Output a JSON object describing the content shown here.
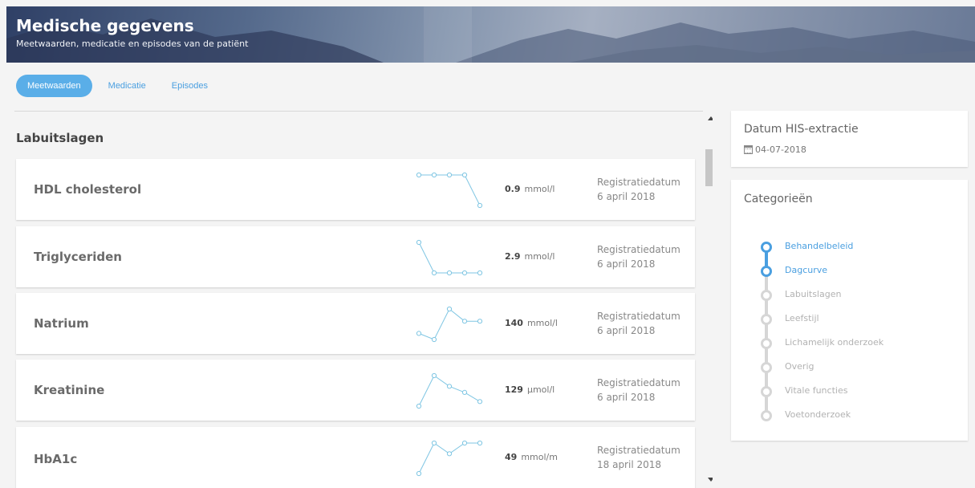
{
  "banner": {
    "title": "Medische gegevens",
    "subtitle": "Meetwaarden, medicatie en episodes van de patiënt"
  },
  "tabs": [
    {
      "label": "Meetwaarden",
      "active": true
    },
    {
      "label": "Medicatie",
      "active": false
    },
    {
      "label": "Episodes",
      "active": false
    }
  ],
  "section": {
    "title": "Labuitslagen"
  },
  "measurements": [
    {
      "name": "HDL cholesterol",
      "value": "0.9",
      "unit": "mmol/l",
      "reg_label": "Registratiedatum",
      "reg_date": "6 april 2018",
      "trend": [
        1,
        1,
        1,
        1,
        0
      ]
    },
    {
      "name": "Triglyceriden",
      "value": "2.9",
      "unit": "mmol/l",
      "reg_label": "Registratiedatum",
      "reg_date": "6 april 2018",
      "trend": [
        1,
        0,
        0,
        0,
        0
      ]
    },
    {
      "name": "Natrium",
      "value": "140",
      "unit": "mmol/l",
      "reg_label": "Registratiedatum",
      "reg_date": "6 april 2018",
      "trend": [
        0.2,
        0,
        1,
        0.6,
        0.6
      ]
    },
    {
      "name": "Kreatinine",
      "value": "129",
      "unit": "μmol/l",
      "reg_label": "Registratiedatum",
      "reg_date": "6 april 2018",
      "trend": [
        0,
        1,
        0.65,
        0.45,
        0.15
      ]
    },
    {
      "name": "HbA1c",
      "value": "49",
      "unit": "mmol/m",
      "reg_label": "Registratiedatum",
      "reg_date": "18 april 2018",
      "trend": [
        0,
        1,
        0.65,
        1,
        1
      ]
    }
  ],
  "his": {
    "heading": "Datum HIS-extractie",
    "date": "04-07-2018"
  },
  "categories": {
    "heading": "Categorieën",
    "items": [
      {
        "label": "Behandelbeleid",
        "active": true
      },
      {
        "label": "Dagcurve",
        "active": true
      },
      {
        "label": "Labuitslagen",
        "active": false
      },
      {
        "label": "Leefstijl",
        "active": false
      },
      {
        "label": "Lichamelijk onderzoek",
        "active": false
      },
      {
        "label": "Overig",
        "active": false
      },
      {
        "label": "Vitale functies",
        "active": false
      },
      {
        "label": "Voetonderzoek",
        "active": false
      }
    ]
  },
  "colors": {
    "accent": "#4a9fe0",
    "spark": "#7fc6e3",
    "inactive": "#d6d6d6"
  }
}
